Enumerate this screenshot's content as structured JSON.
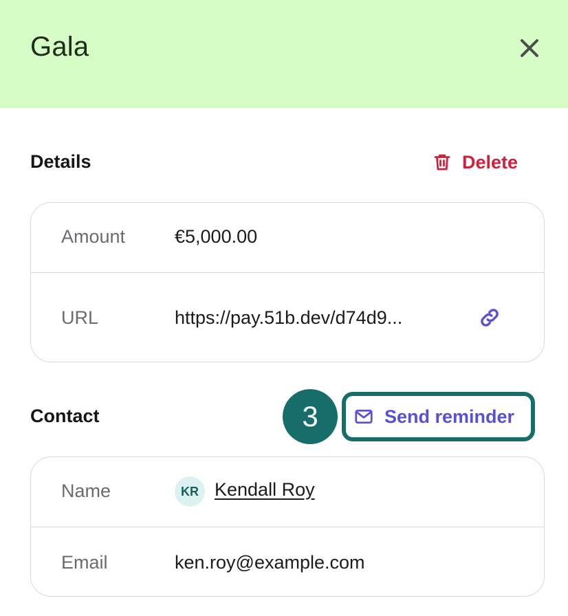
{
  "header": {
    "title": "Gala",
    "background": "#d6fdc6"
  },
  "details": {
    "title": "Details",
    "delete_label": "Delete",
    "rows": [
      {
        "label": "Amount",
        "value": "€5,000.00"
      },
      {
        "label": "URL",
        "value": "https://pay.51b.dev/d74d9...",
        "icon": "link-icon"
      }
    ]
  },
  "contact": {
    "title": "Contact",
    "send_reminder_label": "Send reminder",
    "step_number": "3",
    "name_label": "Name",
    "avatar_initials": "KR",
    "name_value": "Kendall Roy",
    "email_label": "Email",
    "email_value": "ken.roy@example.com"
  },
  "colors": {
    "delete": "#d21f3c",
    "accent": "#5a4fd6",
    "highlight": "#176d6a"
  },
  "icons": {
    "close": "close-icon",
    "delete": "trash-icon",
    "link": "link-icon",
    "reminder": "mail-icon"
  }
}
